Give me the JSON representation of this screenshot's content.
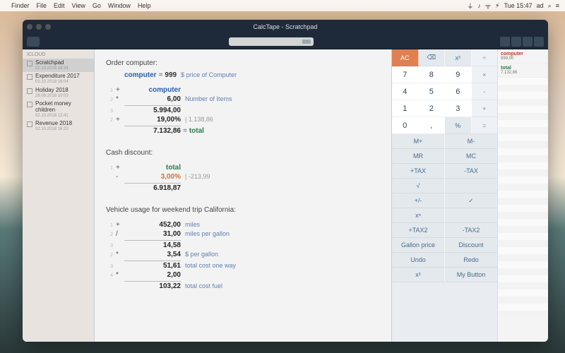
{
  "menubar": {
    "apple": "",
    "items": [
      "Finder",
      "File",
      "Edit",
      "View",
      "Go",
      "Window",
      "Help"
    ],
    "right": [
      "⏚",
      "♪",
      "ᯤ",
      "⚡︎",
      "Tue 15:47",
      "ad",
      "⌕",
      "≡"
    ]
  },
  "window": {
    "title": "CalcTape - Scratchpad"
  },
  "sidebar": {
    "section": "ICLOUD",
    "files": [
      {
        "name": "Scratchpad",
        "date": "02.10.2018 16:34",
        "selected": true
      },
      {
        "name": "Expenditure 2017",
        "date": "01.10.2018 16:04",
        "selected": false
      },
      {
        "name": "Holiday 2018",
        "date": "28.09.2018 10:03",
        "selected": false
      },
      {
        "name": "Pocket money children",
        "date": "02.10.2018 12:41",
        "selected": false
      },
      {
        "name": "Revenue 2018",
        "date": "02.10.2018 16:20",
        "selected": false
      }
    ]
  },
  "tape": {
    "section1": {
      "heading": "Order computer:",
      "defline": {
        "var": "computer",
        "eq": "=",
        "val": "999",
        "note": "$ price of Computer"
      },
      "l1": {
        "ln": "1",
        "op": "+",
        "val": "computer",
        "note": ""
      },
      "l2": {
        "ln": "2",
        "op": "*",
        "val": "6,00",
        "note": "Number of Items"
      },
      "l3": {
        "ln": "3",
        "op": "",
        "val": "5.994,00",
        "note": ""
      },
      "l4": {
        "ln": "2",
        "op": "+",
        "val": "19,00%",
        "note": "|  1.138,86"
      },
      "l5": {
        "ln": "",
        "op": "",
        "val": "7.132,86",
        "eq": "= ",
        "res": "total"
      }
    },
    "section2": {
      "heading": "Cash discount:",
      "l1": {
        "ln": "1",
        "op": "+",
        "val": "total",
        "note": ""
      },
      "l2": {
        "ln": "",
        "op": "-",
        "val": "3,00%",
        "note": "|  -213,99"
      },
      "l3": {
        "ln": "",
        "op": "",
        "val": "6.918,87",
        "note": ""
      }
    },
    "section3": {
      "heading": "Vehicle usage for weekend trip California:",
      "l1": {
        "ln": "1",
        "op": "+",
        "val": "452,00",
        "note": "miles"
      },
      "l2": {
        "ln": "2",
        "op": "/",
        "val": "31,00",
        "note": "miles per gallon"
      },
      "l3": {
        "ln": "3",
        "op": "",
        "val": "14,58",
        "note": ""
      },
      "l4": {
        "ln": "2",
        "op": "*",
        "val": "3,54",
        "note": "$ per gallon"
      },
      "l5": {
        "ln": "3",
        "op": "",
        "val": "51,61",
        "note": "total cost one way"
      },
      "l6": {
        "ln": "4",
        "op": "*",
        "val": "2,00",
        "note": ""
      },
      "l7": {
        "ln": "",
        "op": "",
        "val": "103,22",
        "note": "total cost fuel"
      }
    }
  },
  "keypad": {
    "r1": [
      "AC",
      "⌫",
      "x²",
      "÷"
    ],
    "r2": [
      "7",
      "8",
      "9",
      "×"
    ],
    "r3": [
      "4",
      "5",
      "6",
      "-"
    ],
    "r4": [
      "1",
      "2",
      "3",
      "+"
    ],
    "r5": [
      "0",
      ",",
      "%",
      "="
    ],
    "r6": [
      "M+",
      "M-"
    ],
    "r7": [
      "MR",
      "MC"
    ],
    "r8": [
      "+TAX",
      "-TAX"
    ],
    "r9": [
      "√",
      ""
    ],
    "r10": [
      "+/-",
      "✓"
    ],
    "r11": [
      "xⁿ",
      ""
    ],
    "r12": [
      "+TAX2",
      "-TAX2"
    ],
    "r13": [
      "Gallon price",
      "Discount"
    ],
    "r14": [
      "Undo",
      "Redo"
    ],
    "r15": [
      "x²",
      "My Button"
    ]
  },
  "vars": {
    "v1": {
      "name": "computer",
      "val": "999,00"
    },
    "v2": {
      "name": "total",
      "val": "7.132,86"
    }
  }
}
